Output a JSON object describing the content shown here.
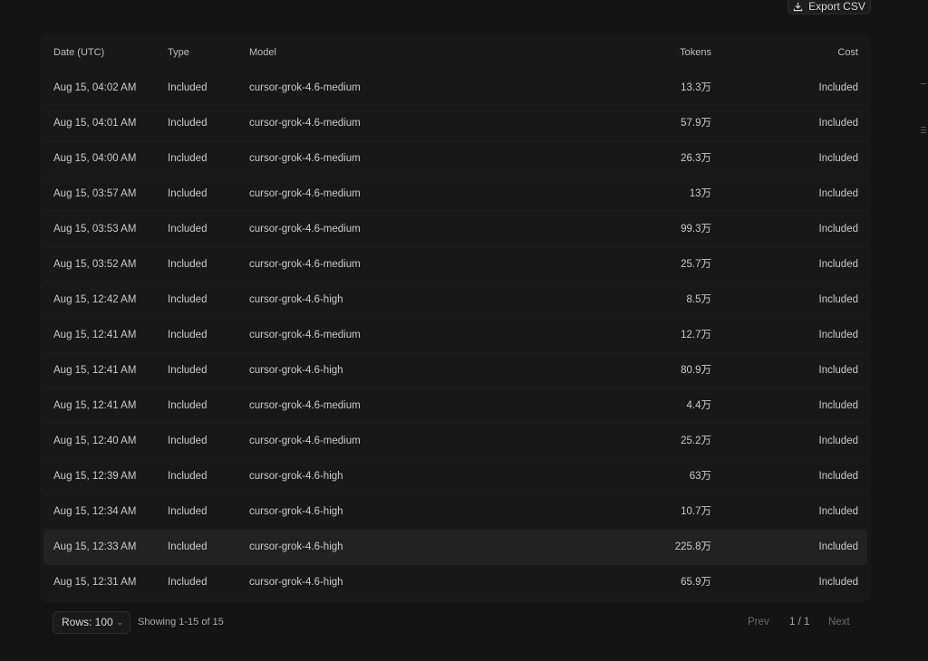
{
  "toolbar": {
    "export_label": "Export CSV"
  },
  "table": {
    "headers": {
      "date": "Date (UTC)",
      "type": "Type",
      "model": "Model",
      "tokens": "Tokens",
      "cost": "Cost"
    },
    "rows": [
      {
        "date": "Aug 15, 04:02 AM",
        "type": "Included",
        "model": "cursor-grok-4.6-medium",
        "tokens": "13.3万",
        "cost": "Included"
      },
      {
        "date": "Aug 15, 04:01 AM",
        "type": "Included",
        "model": "cursor-grok-4.6-medium",
        "tokens": "57.9万",
        "cost": "Included"
      },
      {
        "date": "Aug 15, 04:00 AM",
        "type": "Included",
        "model": "cursor-grok-4.6-medium",
        "tokens": "26.3万",
        "cost": "Included"
      },
      {
        "date": "Aug 15, 03:57 AM",
        "type": "Included",
        "model": "cursor-grok-4.6-medium",
        "tokens": "13万",
        "cost": "Included"
      },
      {
        "date": "Aug 15, 03:53 AM",
        "type": "Included",
        "model": "cursor-grok-4.6-medium",
        "tokens": "99.3万",
        "cost": "Included"
      },
      {
        "date": "Aug 15, 03:52 AM",
        "type": "Included",
        "model": "cursor-grok-4.6-medium",
        "tokens": "25.7万",
        "cost": "Included"
      },
      {
        "date": "Aug 15, 12:42 AM",
        "type": "Included",
        "model": "cursor-grok-4.6-high",
        "tokens": "8.5万",
        "cost": "Included"
      },
      {
        "date": "Aug 15, 12:41 AM",
        "type": "Included",
        "model": "cursor-grok-4.6-medium",
        "tokens": "12.7万",
        "cost": "Included"
      },
      {
        "date": "Aug 15, 12:41 AM",
        "type": "Included",
        "model": "cursor-grok-4.6-high",
        "tokens": "80.9万",
        "cost": "Included"
      },
      {
        "date": "Aug 15, 12:41 AM",
        "type": "Included",
        "model": "cursor-grok-4.6-medium",
        "tokens": "4.4万",
        "cost": "Included"
      },
      {
        "date": "Aug 15, 12:40 AM",
        "type": "Included",
        "model": "cursor-grok-4.6-medium",
        "tokens": "25.2万",
        "cost": "Included"
      },
      {
        "date": "Aug 15, 12:39 AM",
        "type": "Included",
        "model": "cursor-grok-4.6-high",
        "tokens": "63万",
        "cost": "Included"
      },
      {
        "date": "Aug 15, 12:34 AM",
        "type": "Included",
        "model": "cursor-grok-4.6-high",
        "tokens": "10.7万",
        "cost": "Included"
      },
      {
        "date": "Aug 15, 12:33 AM",
        "type": "Included",
        "model": "cursor-grok-4.6-high",
        "tokens": "225.8万",
        "cost": "Included"
      },
      {
        "date": "Aug 15, 12:31 AM",
        "type": "Included",
        "model": "cursor-grok-4.6-high",
        "tokens": "65.9万",
        "cost": "Included"
      }
    ]
  },
  "footer": {
    "rows_select": "Rows: 100",
    "showing": "Showing 1-15 of 15",
    "prev": "Prev",
    "page_indicator": "1 / 1",
    "next": "Next"
  },
  "colors": {
    "background": "#141414",
    "card": "#181818",
    "row_highlight": "#222222"
  },
  "icons": {
    "export": "download-icon",
    "rows_select": "chevron-down-icon"
  }
}
